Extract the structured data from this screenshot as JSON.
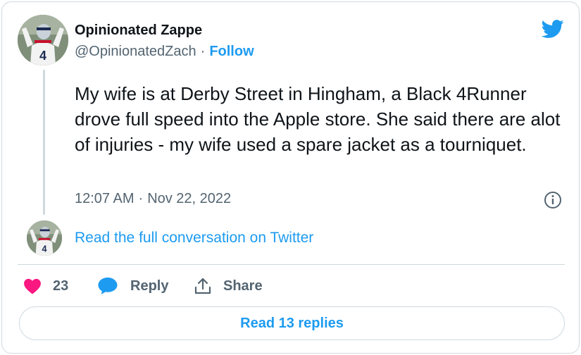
{
  "author": {
    "display_name": "Opinionated Zappe",
    "handle": "@OpinionatedZach",
    "separator": "·",
    "follow_label": "Follow"
  },
  "tweet": {
    "text": "My wife is at Derby Street in Hingham, a Black 4Runner drove full speed into the Apple store. She said there are alot of injuries - my wife used a spare jacket as a tourniquet.",
    "time": "12:07 AM",
    "separator": "·",
    "date": "Nov 22, 2022"
  },
  "conversation_link": "Read the full conversation on Twitter",
  "actions": {
    "like_count": "23",
    "reply_label": "Reply",
    "share_label": "Share"
  },
  "read_replies_label": "Read 13 replies",
  "icons": {
    "brand": "twitter-bird-icon",
    "info": "info-icon",
    "like": "heart-icon",
    "reply": "speech-bubble-icon",
    "share": "share-upload-icon"
  },
  "colors": {
    "accent": "#1d9bf0",
    "like": "#f91880",
    "text_primary": "#0f1419",
    "text_secondary": "#536471",
    "border": "#cfd9de"
  }
}
